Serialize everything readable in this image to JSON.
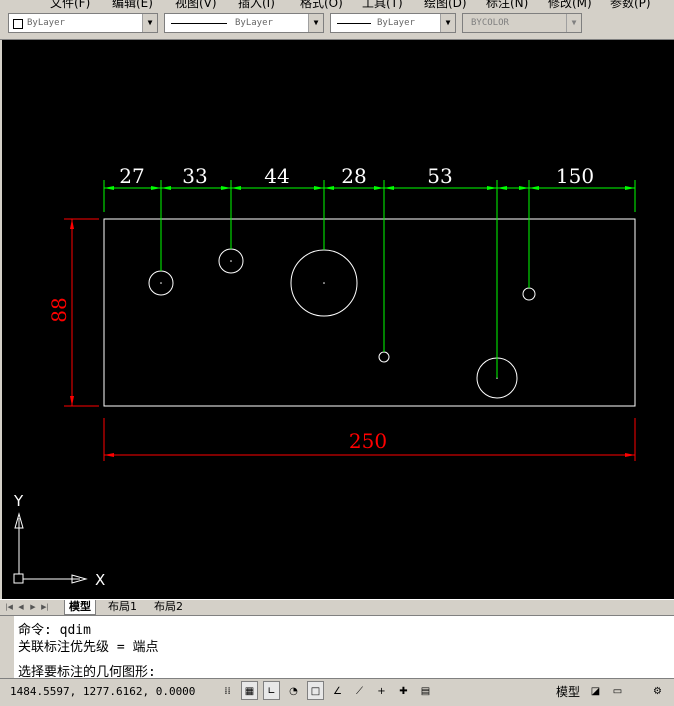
{
  "menu": {
    "items": [
      "文件(F)",
      "编辑(E)",
      "视图(V)",
      "插入(I)",
      "格式(O)",
      "工具(T)",
      "绘图(D)",
      "标注(N)",
      "修改(M)",
      "参数(P)"
    ]
  },
  "properties": {
    "color_label": "ByLayer",
    "linetype_label": "ByLayer",
    "lineweight_label": "ByLayer",
    "plotstyle_label": "BYCOLOR"
  },
  "drawing": {
    "dimensions_top": [
      "27",
      "33",
      "44",
      "28",
      "53",
      "150"
    ],
    "dimension_left": "88",
    "dimension_bottom": "250",
    "ucs_x": "X",
    "ucs_y": "Y",
    "colors": {
      "background": "#000000",
      "dim_green": "#00ff00",
      "dim_red": "#ff0000",
      "geometry": "#ffffff"
    }
  },
  "tabs": {
    "items": [
      "模型",
      "布局1",
      "布局2"
    ],
    "active": "模型"
  },
  "command": {
    "line1": "命令: qdim",
    "line2": "关联标注优先级 = 端点",
    "prompt": "选择要标注的几何图形:"
  },
  "status": {
    "coordinates": "1484.5597, 1277.6162, 0.0000",
    "model_label": "模型"
  }
}
